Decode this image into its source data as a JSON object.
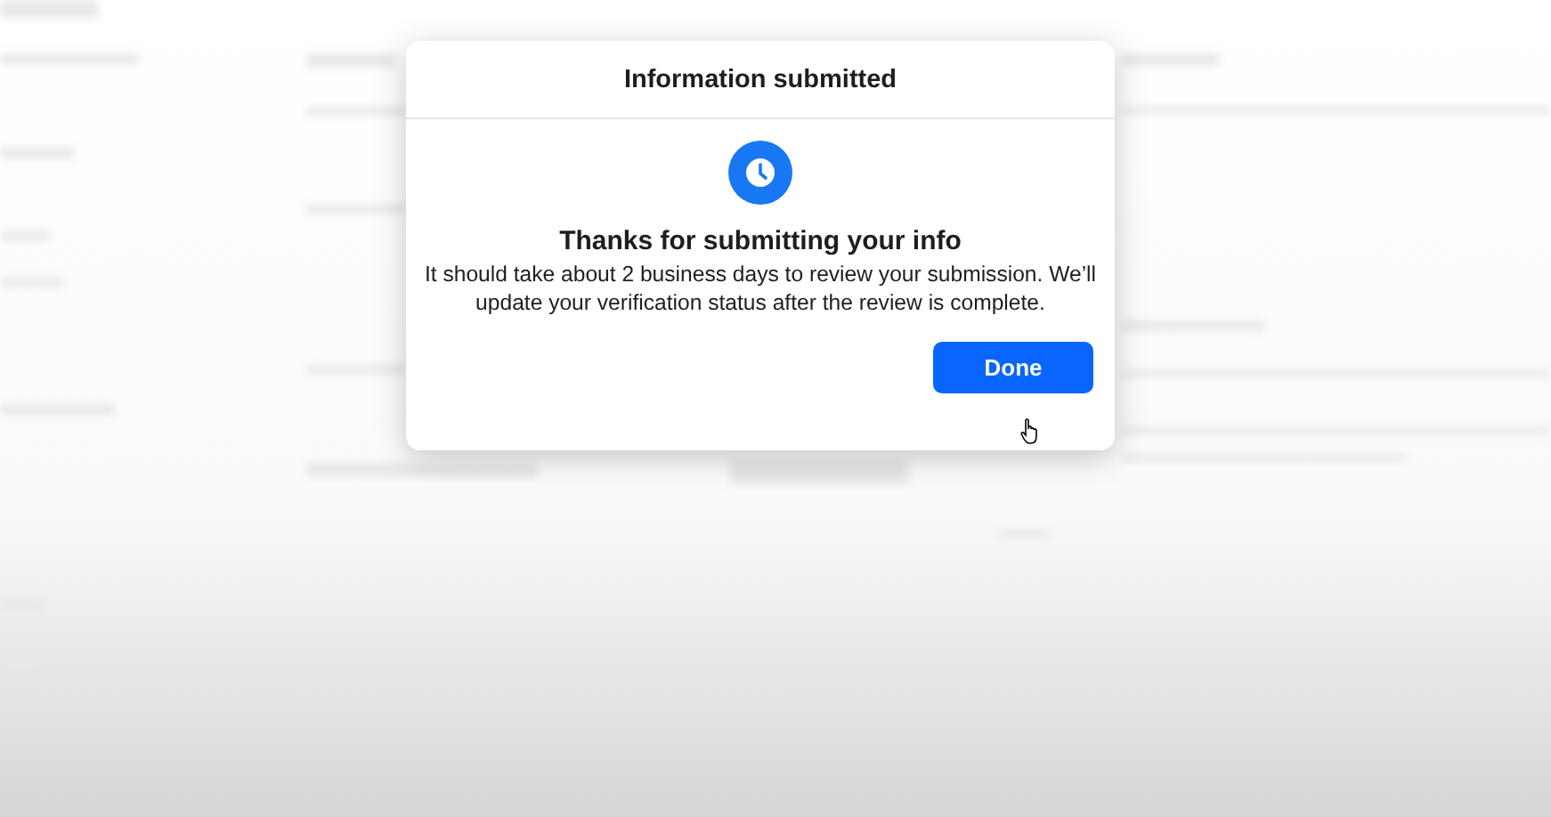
{
  "dialog": {
    "title": "Information submitted",
    "heading": "Thanks for submitting your info",
    "message": "It should take about 2 business days to review your submission. We’ll update your verification status after the review is complete.",
    "buttons": [
      {
        "label": "Done",
        "kind": "primary"
      }
    ]
  }
}
